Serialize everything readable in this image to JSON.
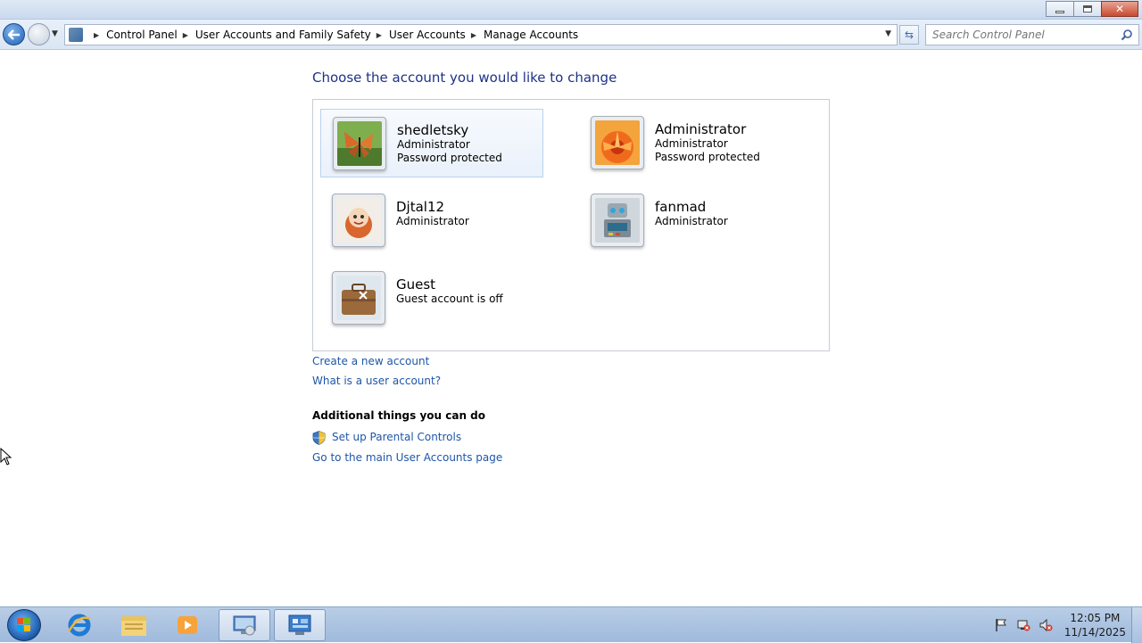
{
  "window": {
    "minimize_label": "minimize",
    "maximize_label": "restore",
    "close_label": "close"
  },
  "breadcrumb": [
    "Control Panel",
    "User Accounts and Family Safety",
    "User Accounts",
    "Manage Accounts"
  ],
  "search": {
    "placeholder": "Search Control Panel"
  },
  "main": {
    "heading": "Choose the account you would like to change",
    "accounts": [
      {
        "name": "shedletsky",
        "lines": [
          "Administrator",
          "Password protected"
        ],
        "picture": "butterfly",
        "selected": true
      },
      {
        "name": "Administrator",
        "lines": [
          "Administrator",
          "Password protected"
        ],
        "picture": "orange-flower",
        "selected": false
      },
      {
        "name": "Djtal12",
        "lines": [
          "Administrator"
        ],
        "picture": "cartoon-character",
        "selected": false
      },
      {
        "name": "fanmad",
        "lines": [
          "Administrator"
        ],
        "picture": "robot",
        "selected": false
      },
      {
        "name": "Guest",
        "lines": [
          "Guest account is off"
        ],
        "picture": "briefcase",
        "selected": false
      }
    ],
    "create_link": "Create a new account",
    "what_link": "What is a user account?",
    "additional_title": "Additional things you can do",
    "parental_link": "Set up Parental Controls",
    "main_page_link": "Go to the main User Accounts page"
  },
  "taskbar": {
    "items": [
      "internet-explorer-icon",
      "windows-explorer-icon",
      "media-player-icon",
      "remote-desktop-icon",
      "control-panel-icon"
    ],
    "clock_time": "12:05 PM",
    "clock_date": "11/14/2025"
  },
  "colors": {
    "link": "#1e56a8",
    "heading": "#1e3287",
    "selected_bg": "#eaf1fb"
  }
}
